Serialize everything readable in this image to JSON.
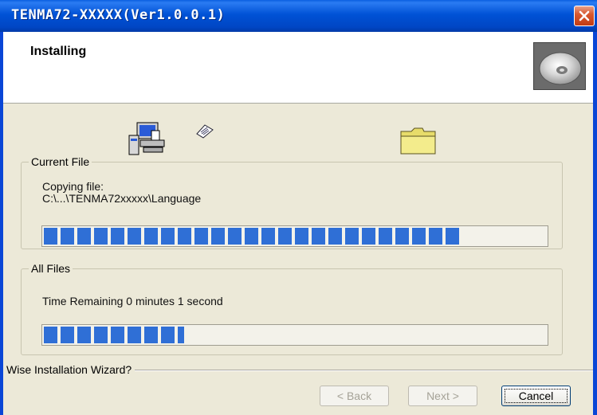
{
  "window": {
    "title": "TENMA72-XXXXX(Ver1.0.0.1)",
    "close_icon": "close-icon"
  },
  "header": {
    "title": "Installing",
    "icon": "cd-disc-icon"
  },
  "animation": {
    "source_icon": "computer-icon",
    "paper_icon": "flying-paper-icon",
    "target_icon": "folder-icon"
  },
  "current_file": {
    "label": "Current File",
    "line1": "Copying file:",
    "line2": "C:\\...\\TENMA72xxxxx\\Language",
    "progress": 0.83
  },
  "all_files": {
    "label": "All Files",
    "time_remaining": "Time Remaining 0 minutes 1 second",
    "progress": 0.28
  },
  "footer": {
    "wizard_label": "Wise Installation Wizard?",
    "back_label": "< Back",
    "next_label": "Next >",
    "cancel_label": "Cancel"
  },
  "colors": {
    "titlebar": "#0054e3",
    "progress": "#2f6fd6",
    "dialog_bg": "#ece9d8"
  }
}
